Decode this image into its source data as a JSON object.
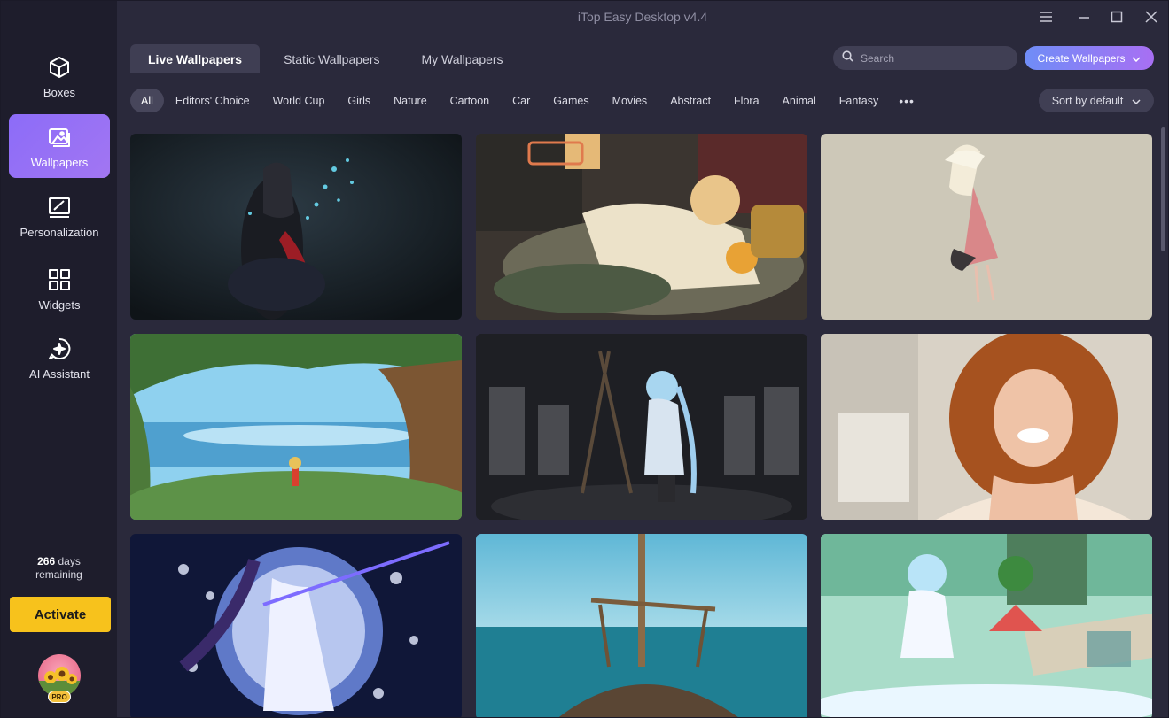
{
  "window": {
    "title": "iTop Easy Desktop v4.4"
  },
  "sidebar": {
    "items": [
      {
        "label": "Boxes",
        "icon": "cube-icon"
      },
      {
        "label": "Wallpapers",
        "icon": "image-icon",
        "active": true
      },
      {
        "label": "Personalization",
        "icon": "brush-frame-icon"
      },
      {
        "label": "Widgets",
        "icon": "widgets-grid-icon"
      },
      {
        "label": "AI Assistant",
        "icon": "sparkle-chat-icon"
      }
    ],
    "days_count": "266",
    "days_unit": "days",
    "days_suffix": "remaining",
    "activate_label": "Activate",
    "pro_label": "PRO"
  },
  "tabs": [
    {
      "label": "Live Wallpapers",
      "active": true
    },
    {
      "label": "Static Wallpapers"
    },
    {
      "label": "My Wallpapers"
    }
  ],
  "search": {
    "placeholder": "Search"
  },
  "create_button": {
    "label": "Create Wallpapers"
  },
  "categories": [
    {
      "label": "All",
      "active": true
    },
    {
      "label": "Editors' Choice"
    },
    {
      "label": "World Cup"
    },
    {
      "label": "Girls"
    },
    {
      "label": "Nature"
    },
    {
      "label": "Cartoon"
    },
    {
      "label": "Car"
    },
    {
      "label": "Games"
    },
    {
      "label": "Movies"
    },
    {
      "label": "Abstract"
    },
    {
      "label": "Flora"
    },
    {
      "label": "Animal"
    },
    {
      "label": "Fantasy"
    }
  ],
  "more_label": "•••",
  "sort": {
    "label": "Sort by default"
  },
  "colors": {
    "accent_gradient_start": "#6f8df7",
    "accent_gradient_end": "#a86ff3",
    "activate": "#f7c21c",
    "sidebar_bg": "#1e1d2c",
    "main_bg": "#2a293b"
  }
}
